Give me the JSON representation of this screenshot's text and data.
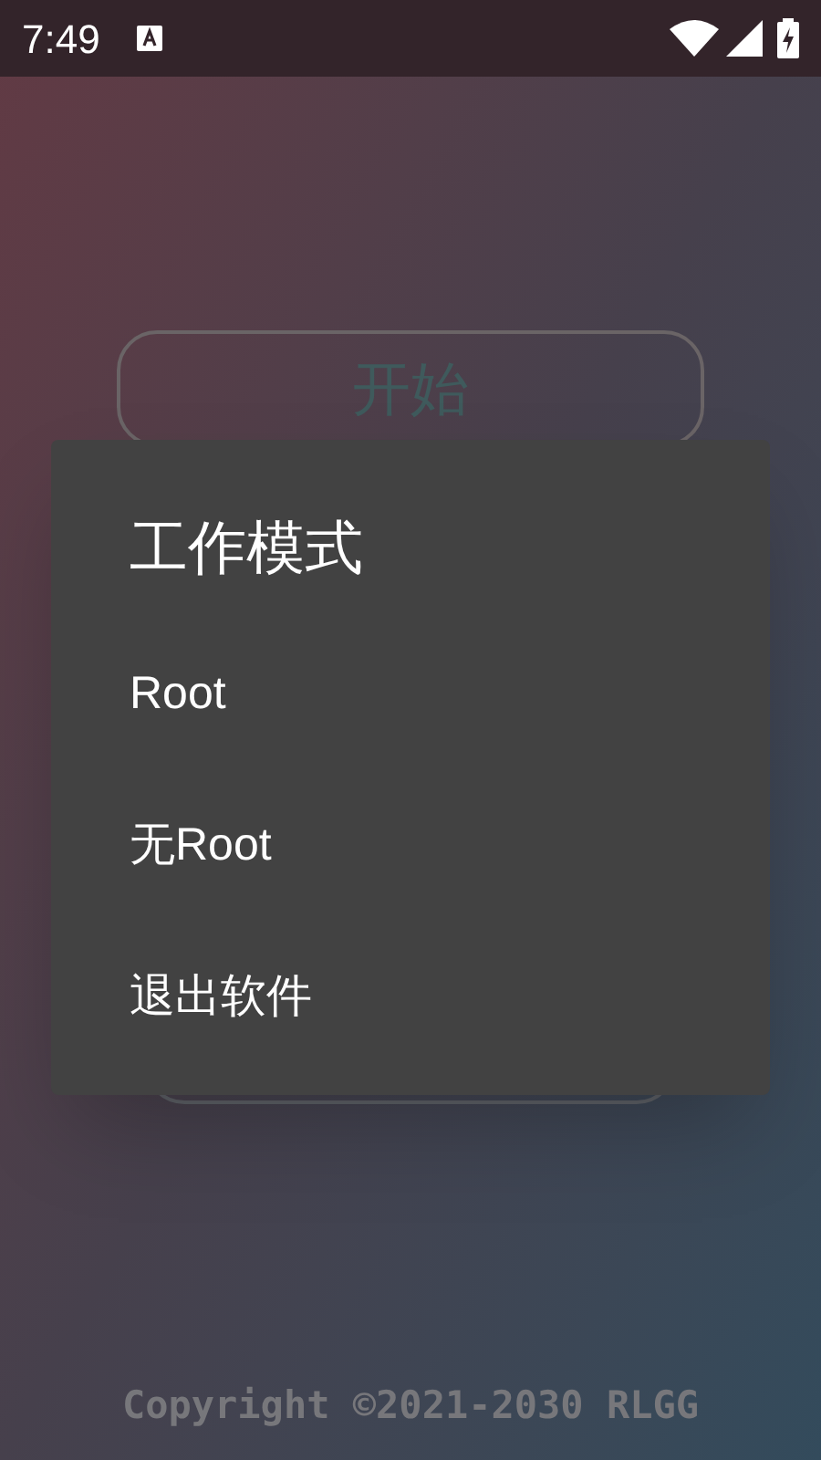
{
  "status_bar": {
    "time": "7:49"
  },
  "start_button": {
    "label": "开始"
  },
  "dialog": {
    "title": "工作模式",
    "items": [
      {
        "label": "Root"
      },
      {
        "label": "无Root"
      },
      {
        "label": "退出软件"
      }
    ]
  },
  "footer": "Copyright ©2021-2030 RLGG"
}
